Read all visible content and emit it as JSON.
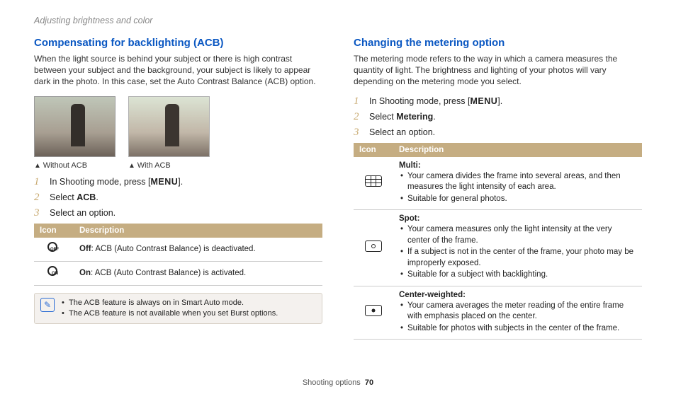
{
  "header": "Adjusting brightness and color",
  "left": {
    "title": "Compensating for backlighting (ACB)",
    "intro": "When the light source is behind your subject or there is high contrast between your subject and the background, your subject is likely to appear dark in the photo. In this case, set the Auto Contrast Balance (ACB) option.",
    "caption_without": "Without ACB",
    "caption_with": "With ACB",
    "step1_pre": "In Shooting mode, press [",
    "step1_btn": "MENU",
    "step1_post": "].",
    "step2_pre": "Select ",
    "step2_bold": "ACB",
    "step2_post": ".",
    "step3": "Select an option.",
    "table": {
      "h_icon": "Icon",
      "h_desc": "Description",
      "rows": [
        {
          "bold": "Off",
          "rest": ": ACB (Auto Contrast Balance) is deactivated."
        },
        {
          "bold": "On",
          "rest": ": ACB (Auto Contrast Balance) is activated."
        }
      ]
    },
    "notes": [
      "The ACB feature is always on in Smart Auto mode.",
      "The ACB feature is not available when you set Burst options."
    ]
  },
  "right": {
    "title": "Changing the metering option",
    "intro": "The metering mode refers to the way in which a camera measures the quantity of light. The brightness and lighting of your photos will vary depending on the metering mode you select.",
    "step1_pre": "In Shooting mode, press [",
    "step1_btn": "MENU",
    "step1_post": "].",
    "step2_pre": "Select ",
    "step2_bold": "Metering",
    "step2_post": ".",
    "step3": "Select an option.",
    "table": {
      "h_icon": "Icon",
      "h_desc": "Description",
      "rows": [
        {
          "title": "Multi",
          "bullets": [
            "Your camera divides the frame into several areas, and then measures the light intensity of each area.",
            "Suitable for general photos."
          ]
        },
        {
          "title": "Spot",
          "bullets": [
            "Your camera measures only the light intensity at the very center of the frame.",
            "If a subject is not in the center of the frame, your photo may be improperly exposed.",
            "Suitable for a subject with backlighting."
          ]
        },
        {
          "title": "Center-weighted",
          "bullets": [
            "Your camera averages the meter reading of the entire frame with emphasis placed on the center.",
            "Suitable for photos with subjects in the center of the frame."
          ]
        }
      ]
    }
  },
  "footer": {
    "section": "Shooting options",
    "page": "70"
  }
}
